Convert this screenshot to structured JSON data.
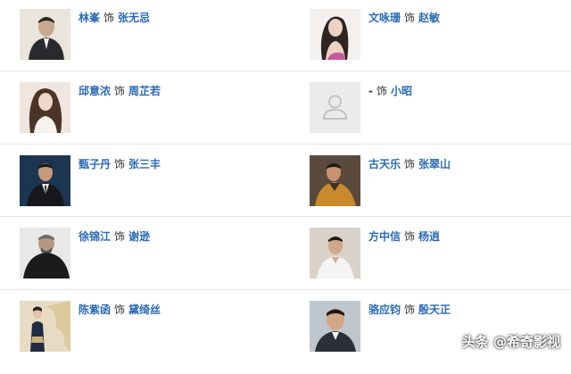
{
  "role_separator": "饰",
  "cast": [
    {
      "actor": "林峯",
      "character": "张无忌",
      "photo_icon": "actor-photo-icon"
    },
    {
      "actor": "文咏珊",
      "character": "赵敏",
      "photo_icon": "actor-photo-icon"
    },
    {
      "actor": "邱意浓",
      "character": "周芷若",
      "photo_icon": "actor-photo-icon"
    },
    {
      "actor": "-",
      "character": "小昭",
      "photo_icon": "placeholder-person-icon"
    },
    {
      "actor": "甄子丹",
      "character": "张三丰",
      "photo_icon": "actor-photo-icon"
    },
    {
      "actor": "古天乐",
      "character": "张翠山",
      "photo_icon": "actor-photo-icon"
    },
    {
      "actor": "徐锦江",
      "character": "谢逊",
      "photo_icon": "actor-photo-icon"
    },
    {
      "actor": "方中信",
      "character": "杨逍",
      "photo_icon": "actor-photo-icon"
    },
    {
      "actor": "陈紫函",
      "character": "黛绮丝",
      "photo_icon": "actor-photo-icon"
    },
    {
      "actor": "骆应钧",
      "character": "殷天正",
      "photo_icon": "actor-photo-icon"
    }
  ],
  "watermark": "头条 @希奇影视",
  "colors": {
    "link": "#2a6ab6",
    "text": "#333333",
    "divider": "#e6e6e6"
  }
}
